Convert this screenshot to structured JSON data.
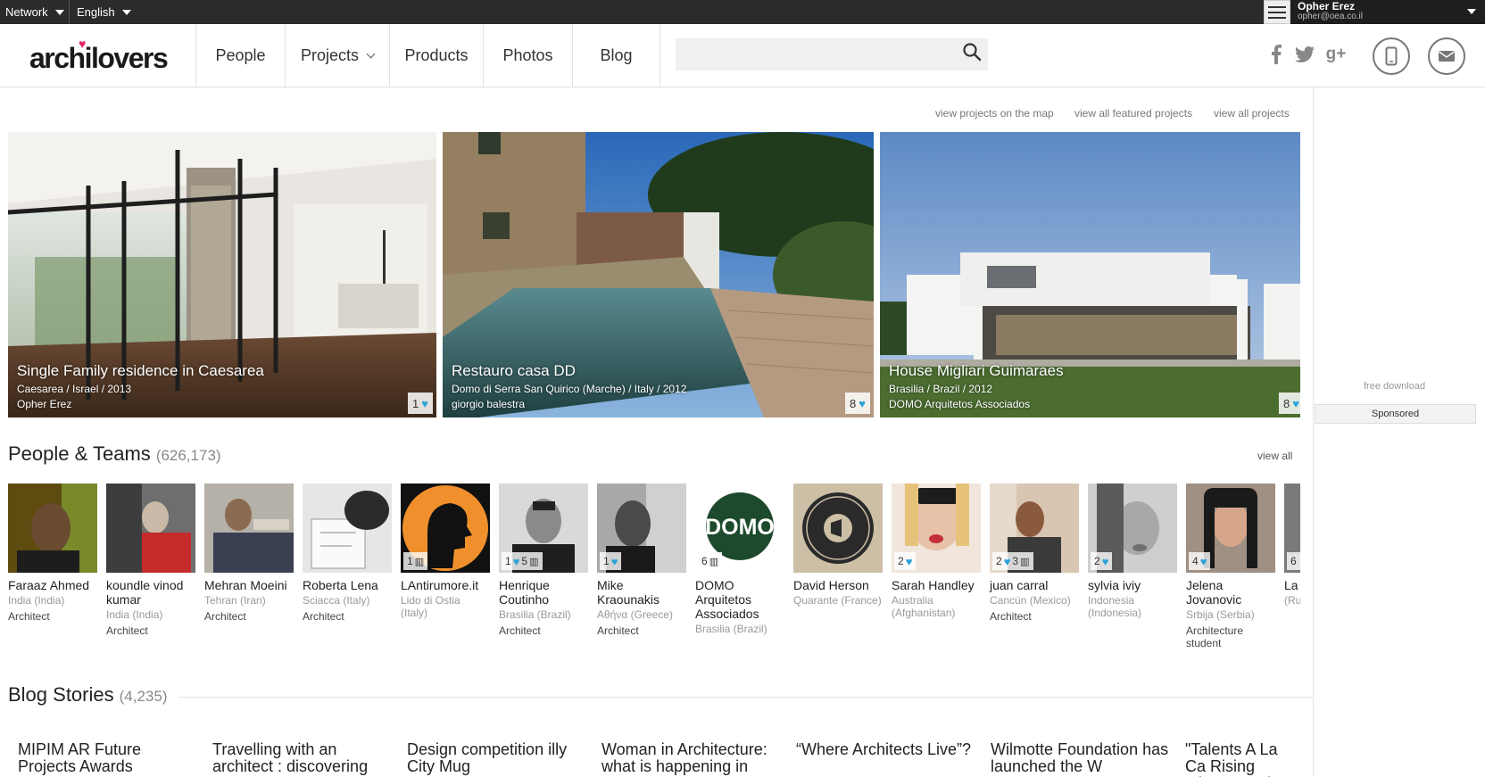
{
  "topbar": {
    "network": "Network",
    "language": "English",
    "user_name": "Opher Erez",
    "user_email": "opher@oea.co.il"
  },
  "header": {
    "logo": "archilovers",
    "nav": [
      {
        "label": "People"
      },
      {
        "label": "Projects"
      },
      {
        "label": "Products"
      },
      {
        "label": "Photos"
      },
      {
        "label": "Blog"
      }
    ],
    "search_placeholder": ""
  },
  "links": {
    "map": "view projects on the map",
    "featured": "view all featured projects",
    "all": "view all projects"
  },
  "featured": [
    {
      "title": "Single Family residence in Caesarea",
      "sub": "Caesarea / Israel / 2013",
      "author": "Opher Erez",
      "likes": "1"
    },
    {
      "title": "Restauro casa DD",
      "sub": "Domo di Serra San Quirico (Marche) / Italy / 2012",
      "author": "giorgio balestra",
      "likes": "8"
    },
    {
      "title": "House Migliari Guimaraes",
      "sub": "Brasilia / Brazil / 2012",
      "author": "DOMO Arquitetos Associados",
      "likes": "8"
    }
  ],
  "sidebar": {
    "free_download": "free download",
    "sponsored": "Sponsored"
  },
  "people": {
    "title": "People & Teams",
    "count": "(626,173)",
    "view_all": "view all",
    "items": [
      {
        "name": "Faraaz Ahmed",
        "loc": "India (India)",
        "role": "Architect"
      },
      {
        "name": "koundle vinod kumar",
        "loc": "India (India)",
        "role": "Architect"
      },
      {
        "name": "Mehran Moeini",
        "loc": "Tehran (Iran)",
        "role": "Architect"
      },
      {
        "name": "Roberta Lena",
        "loc": "Sciacca (Italy)",
        "role": "Architect"
      },
      {
        "name": "LAntirumore.it",
        "loc": "Lido di Ostia (Italy)",
        "role": "",
        "badge": "1"
      },
      {
        "name": "Henrique Coutinho",
        "loc": "Brasilia (Brazil)",
        "role": "Architect",
        "badge": "1",
        "badge2": "5"
      },
      {
        "name": "Mike Kraounakis",
        "loc": "Αθήνα (Greece)",
        "role": "Architect",
        "badge": "1"
      },
      {
        "name": "DOMO Arquitetos Associados",
        "loc": "Brasilia (Brazil)",
        "role": "",
        "badge2": "6"
      },
      {
        "name": "David Herson",
        "loc": "Quarante (France)",
        "role": ""
      },
      {
        "name": "Sarah Handley",
        "loc": "Australia (Afghanistan)",
        "role": "",
        "badge": "2"
      },
      {
        "name": "juan carral",
        "loc": "Cancún (Mexico)",
        "role": "Architect",
        "badge": "2",
        "badge2": "3"
      },
      {
        "name": "sylvia iviy",
        "loc": "Indonesia (Indonesia)",
        "role": "",
        "badge": "2"
      },
      {
        "name": "Jelena Jovanovic",
        "loc": "Srbija (Serbia)",
        "role": "Architecture student",
        "badge": "4"
      },
      {
        "name": "La Ro",
        "loc": "(Ru",
        "role": "",
        "badge2": "6"
      }
    ]
  },
  "blog": {
    "title": "Blog Stories",
    "count": "(4,235)",
    "items": [
      {
        "title": "MIPIM AR Future Projects Awards"
      },
      {
        "title": "Travelling with an architect : discovering"
      },
      {
        "title": "Design competition illy City Mug"
      },
      {
        "title": "Woman in Architecture: what is happening in"
      },
      {
        "title": "“Where Architects Live”?"
      },
      {
        "title": "Wilmotte Foundation has launched the W"
      },
      {
        "title": "\"Talents A La Ca Rising talents on sho"
      }
    ]
  },
  "colors": {
    "topbar": "#2b2b2b",
    "heart": "#2aa3d8",
    "logo_heart": "#e0245e"
  }
}
